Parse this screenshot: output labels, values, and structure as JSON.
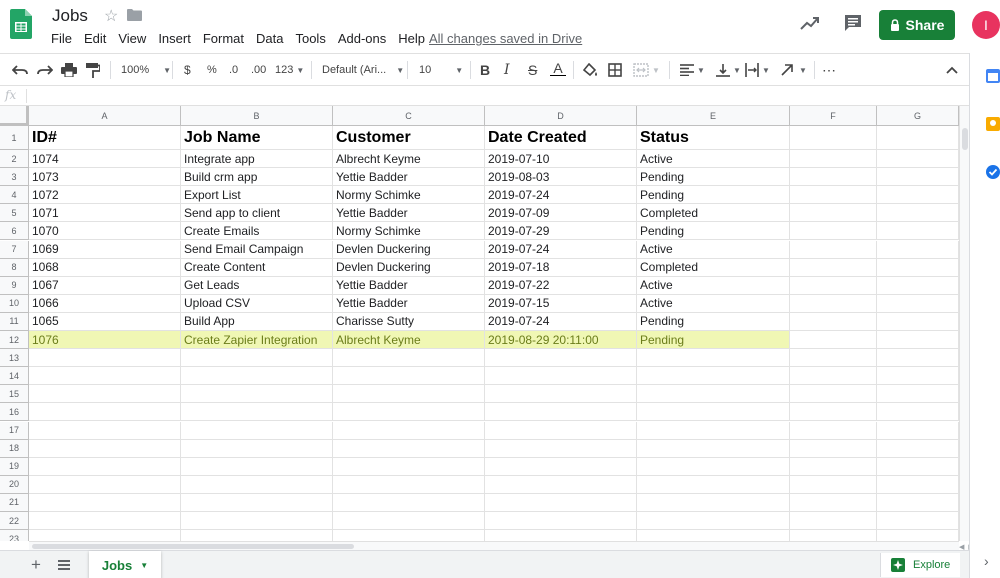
{
  "app": {
    "title": "Jobs",
    "save_status": "All changes saved in Drive",
    "share_label": "Share",
    "avatar_initial": "I",
    "brand_green": "#188038",
    "avatar_color": "#e8335f"
  },
  "menu": [
    "File",
    "Edit",
    "View",
    "Insert",
    "Format",
    "Data",
    "Tools",
    "Add-ons",
    "Help"
  ],
  "toolbar": {
    "zoom": "100%",
    "currency": "$",
    "percent": "%",
    "decrease_decimal": ".0",
    "increase_decimal": ".00",
    "more_formats": "123",
    "font_family": "Default (Ari...",
    "font_size": "10",
    "bold": "B",
    "italic": "I",
    "strikethrough": "S",
    "text_color": "A",
    "more": "⋯"
  },
  "formula_bar": {
    "fx_label": "fx",
    "value": ""
  },
  "columns": [
    "A",
    "B",
    "C",
    "D",
    "E",
    "F",
    "G"
  ],
  "header_row": [
    "ID#",
    "Job Name",
    "Customer",
    "Date Created",
    "Status"
  ],
  "rows": [
    [
      "1074",
      "Integrate app",
      "Albrecht Keyme",
      "2019-07-10",
      "Active"
    ],
    [
      "1073",
      "Build crm app",
      "Yettie Badder",
      "2019-08-03",
      "Pending"
    ],
    [
      "1072",
      "Export List",
      "Normy Schimke",
      "2019-07-24",
      "Pending"
    ],
    [
      "1071",
      "Send app to client",
      "Yettie Badder",
      "2019-07-09",
      "Completed"
    ],
    [
      "1070",
      "Create Emails",
      "Normy Schimke",
      "2019-07-29",
      "Pending"
    ],
    [
      "1069",
      "Send Email Campaign",
      "Devlen Duckering",
      "2019-07-24",
      "Active"
    ],
    [
      "1068",
      "Create Content",
      "Devlen Duckering",
      "2019-07-18",
      "Completed"
    ],
    [
      "1067",
      "Get Leads",
      "Yettie Badder",
      "2019-07-22",
      "Active"
    ],
    [
      "1066",
      "Upload CSV",
      "Yettie Badder",
      "2019-07-15",
      "Active"
    ],
    [
      "1065",
      "Build App",
      "Charisse Sutty",
      "2019-07-24",
      "Pending"
    ],
    [
      "1076",
      "Create Zapier Integration",
      "Albrecht Keyme",
      "2019-08-29 20:11:00",
      "Pending"
    ]
  ],
  "highlight_row_color": "#f0f7b4",
  "row_numbers": [
    "1",
    "2",
    "3",
    "4",
    "5",
    "6",
    "7",
    "8",
    "9",
    "10",
    "11",
    "12",
    "13",
    "14",
    "15",
    "16",
    "17",
    "18",
    "19",
    "20",
    "21",
    "22",
    "23"
  ],
  "sheet_tab": {
    "label": "Jobs"
  },
  "explore_label": "Explore",
  "icons": {
    "logo": "sheets-logo-icon",
    "star": "star-icon",
    "folder": "folder-icon",
    "trend": "trending-up-icon",
    "comment": "comment-icon",
    "lock": "lock-icon",
    "add_sheet": "plus-icon",
    "all_sheets": "list-icon",
    "explore": "explore-icon",
    "calendar": "calendar-icon",
    "keep": "keep-icon",
    "tasks": "tasks-icon"
  }
}
